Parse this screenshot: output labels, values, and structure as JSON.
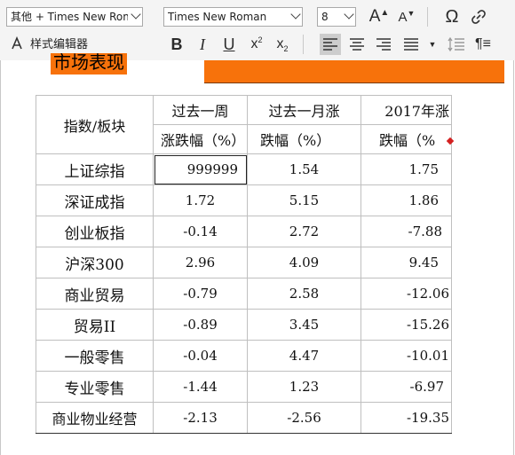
{
  "toolbar": {
    "style_dropdown": "其他 + Times New Roma",
    "font_dropdown": "Times New Roman",
    "size_dropdown": "8",
    "style_editor_label": "样式编辑器",
    "grow_font_label": "A",
    "shrink_font_label": "A",
    "omega_label": "Ω",
    "bold_label": "B",
    "italic_label": "I",
    "underline_label": "U",
    "superscript_label": "x",
    "superscript_mark": "2",
    "subscript_label": "x",
    "subscript_mark": "2",
    "pilcrow_label": "¶≡"
  },
  "document": {
    "heading": "市场表现"
  },
  "table": {
    "header_row1": [
      "指数/板块",
      "过去一周",
      "过去一月涨",
      "2017年涨"
    ],
    "header_row2": [
      "涨跌幅（%）",
      "跌幅（%）",
      "跌幅（%"
    ],
    "rows": [
      [
        "上证综指",
        "999999",
        "1.54",
        "1.75"
      ],
      [
        "深证成指",
        "1.72",
        "5.15",
        "1.86"
      ],
      [
        "创业板指",
        "-0.14",
        "2.72",
        "-7.88"
      ],
      [
        "沪深300",
        "2.96",
        "4.09",
        "9.45"
      ],
      [
        "商业贸易",
        "-0.79",
        "2.58",
        "-12.06"
      ],
      [
        "贸易II",
        "-0.89",
        "3.45",
        "-15.26"
      ],
      [
        "一般零售",
        "-0.04",
        "4.47",
        "-10.01"
      ],
      [
        "专业零售",
        "-1.44",
        "1.23",
        "-6.97"
      ],
      [
        "商业物业经营",
        "-2.13",
        "-2.56",
        "-19.35"
      ]
    ]
  },
  "colors": {
    "accent_orange": "#f7720b",
    "toolbar_bg": "#f4f4f4",
    "active_button": "#cdcdcd"
  }
}
